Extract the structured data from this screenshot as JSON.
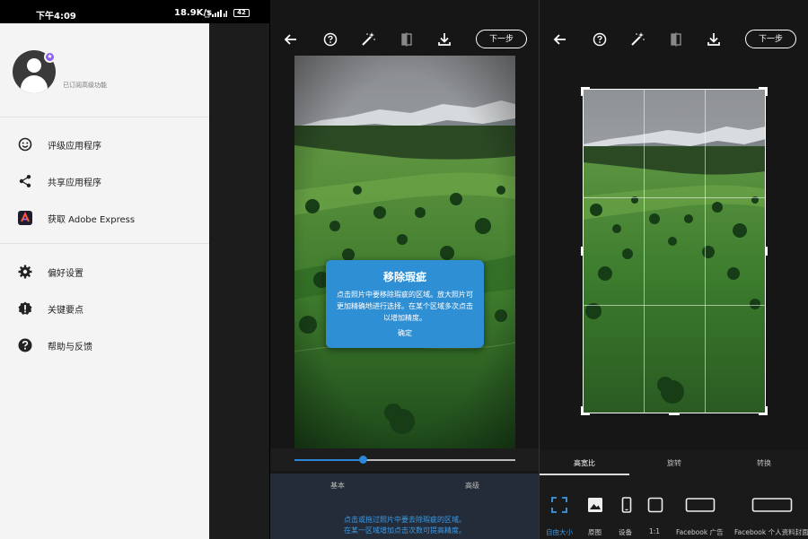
{
  "status_bar": {
    "time": "下午4:09",
    "speed": "18.9K/s",
    "battery": "42"
  },
  "drawer": {
    "profile_subtitle": "已订阅高级功能",
    "menu_group1": [
      {
        "label": "评级应用程序",
        "icon": "smile-icon"
      },
      {
        "label": "共享应用程序",
        "icon": "share-icon"
      },
      {
        "label": "获取 Adobe Express",
        "icon": "adobe-express-icon"
      }
    ],
    "menu_group2": [
      {
        "label": "偏好设置",
        "icon": "gear-icon"
      },
      {
        "label": "关键要点",
        "icon": "alert-icon"
      },
      {
        "label": "帮助与反馈",
        "icon": "help-icon"
      }
    ]
  },
  "editor_heal": {
    "next_label": "下一步",
    "dialog": {
      "title": "移除瑕疵",
      "body": "点击照片中要移除瑕疵的区域。放大照片可更加精确地进行选择。在某个区域多次点击以增加精度。",
      "ok": "确定"
    },
    "slider_value": 0.31,
    "tabs": [
      "基本",
      "高级"
    ],
    "hint_line1": "点击或拖过照片中要去除瑕疵的区域。",
    "hint_line2": "在某一区域增加点击次数可提高精度。"
  },
  "editor_crop": {
    "next_label": "下一步",
    "tabs": [
      "高宽比",
      "旋转",
      "转换"
    ],
    "active_tab": 0,
    "options": [
      "自由大小",
      "原图",
      "设备",
      "1:1",
      "Facebook 广告",
      "Facebook 个人资料封面"
    ],
    "active_option": 0,
    "accent_color": "#3d9ae6"
  },
  "colors": {
    "accent": "#2e86d6",
    "dialog": "#2f8fd4",
    "premium_badge": "#8b5cf6"
  }
}
